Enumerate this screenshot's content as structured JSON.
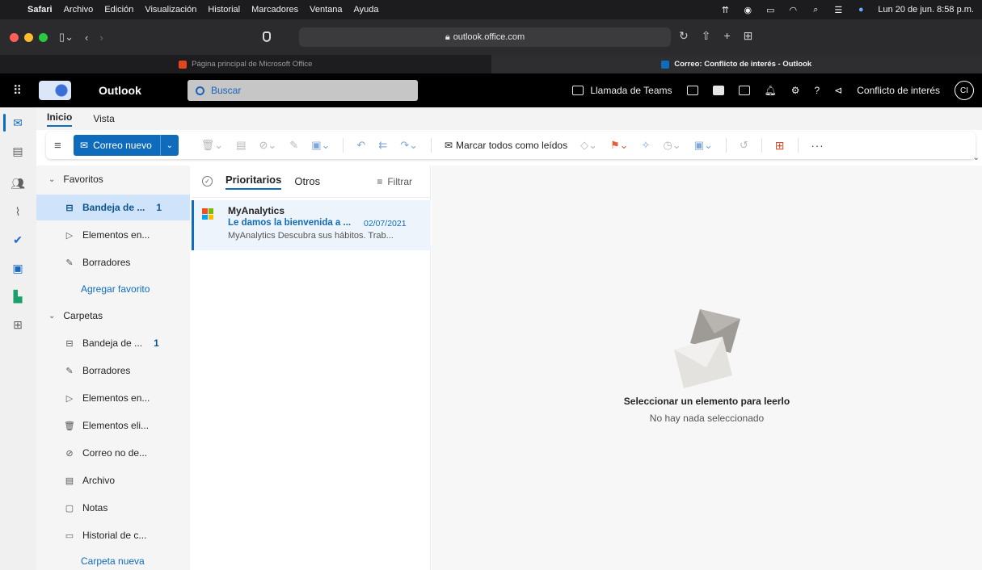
{
  "menubar": {
    "app": "Safari",
    "menus": [
      "Archivo",
      "Edición",
      "Visualización",
      "Historial",
      "Marcadores",
      "Ventana",
      "Ayuda"
    ],
    "clock": "Lun 20 de jun. 8:58 p.m."
  },
  "browser": {
    "url": "outlook.office.com",
    "tabs": [
      {
        "title": "Página principal de Microsoft Office",
        "favicon_color": "#e2461f"
      },
      {
        "title": "Correo: Conflicto de interés - Outlook",
        "favicon_color": "#0f6cbd"
      }
    ]
  },
  "header": {
    "app_name": "Outlook",
    "search_placeholder": "Buscar",
    "teams_call": "Llamada de Teams",
    "account_name": "Conflicto de interés",
    "avatar_initials": "CI"
  },
  "ribbon": {
    "tabs": [
      "Inicio",
      "Vista"
    ],
    "new_mail": "Correo nuevo",
    "mark_all_read": "Marcar todos como leídos",
    "more": "···"
  },
  "folders": {
    "favorites_label": "Favoritos",
    "favorites": [
      {
        "name": "Bandeja de ...",
        "count": "1",
        "icon": "inbox-icon",
        "selected": true
      },
      {
        "name": "Elementos en...",
        "count": "",
        "icon": "send-icon",
        "selected": false
      },
      {
        "name": "Borradores",
        "count": "",
        "icon": "draft-icon",
        "selected": false
      }
    ],
    "add_favorite": "Agregar favorito",
    "folders_label": "Carpetas",
    "folders": [
      {
        "name": "Bandeja de ...",
        "count": "1",
        "icon": "inbox-icon"
      },
      {
        "name": "Borradores",
        "count": "",
        "icon": "draft-icon"
      },
      {
        "name": "Elementos en...",
        "count": "",
        "icon": "send-icon"
      },
      {
        "name": "Elementos eli...",
        "count": "",
        "icon": "trash-icon"
      },
      {
        "name": "Correo no de...",
        "count": "",
        "icon": "junk-icon"
      },
      {
        "name": "Archivo",
        "count": "",
        "icon": "archive-icon"
      },
      {
        "name": "Notas",
        "count": "",
        "icon": "note-icon"
      },
      {
        "name": "Historial de c...",
        "count": "",
        "icon": "folder-icon"
      }
    ],
    "new_folder": "Carpeta nueva"
  },
  "message_list": {
    "tab_focused": "Prioritarios",
    "tab_other": "Otros",
    "filter": "Filtrar",
    "messages": [
      {
        "sender": "MyAnalytics",
        "subject": "Le damos la bienvenida a ...",
        "date": "02/07/2021",
        "preview": "MyAnalytics Descubra sus hábitos. Trab..."
      }
    ]
  },
  "reading_pane": {
    "title": "Seleccionar un elemento para leerlo",
    "subtitle": "No hay nada seleccionado"
  },
  "colors": {
    "accent": "#0f6cbd",
    "selected_folder_bg": "#cfe4fa",
    "header_bg": "#000000"
  }
}
